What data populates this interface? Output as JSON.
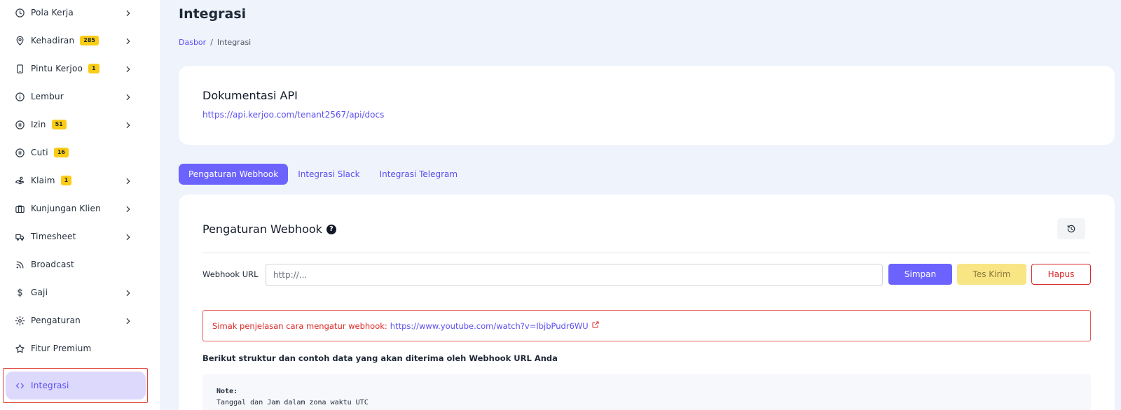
{
  "sidebar": {
    "items": [
      {
        "label": "Pola Kerja",
        "icon": "clock-icon",
        "badge": null,
        "chevron": true
      },
      {
        "label": "Kehadiran",
        "icon": "location-pin-icon",
        "badge": "285",
        "chevron": true
      },
      {
        "label": "Pintu Kerjoo",
        "icon": "tablet-icon",
        "badge": "1",
        "chevron": true
      },
      {
        "label": "Lembur",
        "icon": "info-icon",
        "badge": null,
        "chevron": true
      },
      {
        "label": "Izin",
        "icon": "pause-circle-icon",
        "badge": "51",
        "chevron": true
      },
      {
        "label": "Cuti",
        "icon": "pause-circle-icon",
        "badge": "16",
        "chevron": false
      },
      {
        "label": "Klaim",
        "icon": "hand-coin-icon",
        "badge": "1",
        "chevron": true
      },
      {
        "label": "Kunjungan Klien",
        "icon": "briefcase-icon",
        "badge": null,
        "chevron": true
      },
      {
        "label": "Timesheet",
        "icon": "truck-clock-icon",
        "badge": null,
        "chevron": true
      },
      {
        "label": "Broadcast",
        "icon": "rss-icon",
        "badge": null,
        "chevron": false
      },
      {
        "label": "Gaji",
        "icon": "dollar-icon",
        "badge": null,
        "chevron": true
      },
      {
        "label": "Pengaturan",
        "icon": "gear-icon",
        "badge": null,
        "chevron": true
      },
      {
        "label": "Fitur Premium",
        "icon": "star-icon",
        "badge": null,
        "chevron": false
      },
      {
        "label": "Integrasi",
        "icon": "code-icon",
        "badge": null,
        "chevron": false,
        "active": true
      }
    ]
  },
  "header": {
    "title": "Integrasi",
    "breadcrumb": {
      "home": "Dasbor",
      "separator": "/",
      "current": "Integrasi"
    }
  },
  "api_card": {
    "title": "Dokumentasi API",
    "url": "https://api.kerjoo.com/tenant2567/api/docs"
  },
  "tabs": [
    {
      "label": "Pengaturan Webhook",
      "active": true
    },
    {
      "label": "Integrasi Slack",
      "active": false
    },
    {
      "label": "Integrasi Telegram",
      "active": false
    }
  ],
  "webhook": {
    "title": "Pengaturan Webhook",
    "help_icon": "question-circle-icon",
    "history_icon": "history-icon",
    "url_label": "Webhook URL",
    "url_value": "",
    "url_placeholder": "http://...",
    "save_label": "Simpan",
    "test_label": "Tes Kirim",
    "delete_label": "Hapus",
    "alert_text": "Simak penjelasan cara mengatur webhook:",
    "alert_link": "https://www.youtube.com/watch?v=IbjbPudr6WU",
    "structure_text": "Berikut struktur dan contoh data yang akan diterima oleh Webhook URL Anda",
    "note_title": "Note:",
    "note_line": "Tanggal dan Jam dalam zona waktu UTC"
  },
  "colors": {
    "primary": "#6c63ff",
    "badge": "#facc15",
    "danger": "#dc2626",
    "background": "#eef3fc",
    "active_nav": "#ddd9fd"
  }
}
